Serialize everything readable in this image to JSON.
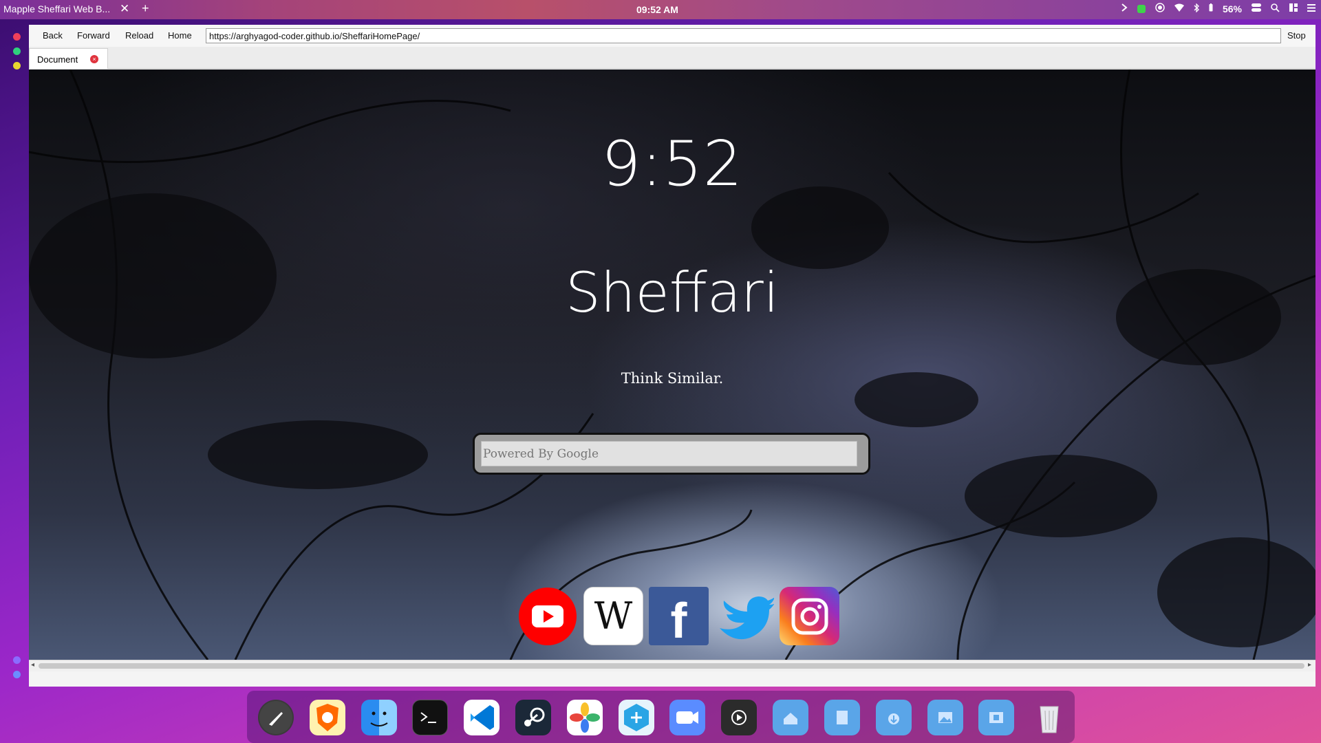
{
  "topbar": {
    "window_title": "Mapple Sheffari Web B...",
    "close_glyph": "✕",
    "new_tab_glyph": "+",
    "clock": "09:52 AM",
    "battery": "56%",
    "icons": [
      "chevron-right-icon",
      "green-status-icon",
      "record-icon",
      "wifi-icon",
      "bluetooth-icon",
      "battery-icon",
      "control-center-icon",
      "search-icon",
      "grid-icon",
      "menu-icon"
    ]
  },
  "navbar": {
    "back": "Back",
    "forward": "Forward",
    "reload": "Reload",
    "home": "Home",
    "url": "https://arghyagod-coder.github.io/SheffariHomePage/",
    "stop": "Stop"
  },
  "tab": {
    "label": "Document",
    "close": "×"
  },
  "page": {
    "clock": "9:52",
    "brand": "Sheffari",
    "tagline": "Think Similar.",
    "search_placeholder": "Powered By Google"
  },
  "social": [
    {
      "name": "youtube-icon",
      "color": "#ff0000"
    },
    {
      "name": "wikipedia-icon",
      "color": "#ffffff"
    },
    {
      "name": "facebook-icon",
      "color": "#3b5998"
    },
    {
      "name": "twitter-icon",
      "color": "#1da1f2"
    },
    {
      "name": "instagram-icon",
      "color": "#d62976"
    }
  ],
  "dock": [
    "launchpad-icon",
    "brave-browser-icon",
    "finder-icon",
    "terminal-icon",
    "vscode-icon",
    "steam-icon",
    "photos-icon",
    "app-store-icon",
    "zoom-icon",
    "video-player-icon",
    "home-folder-icon",
    "documents-folder-icon",
    "downloads-folder-icon",
    "pictures-folder-icon",
    "videos-folder-icon",
    "trash-icon"
  ]
}
